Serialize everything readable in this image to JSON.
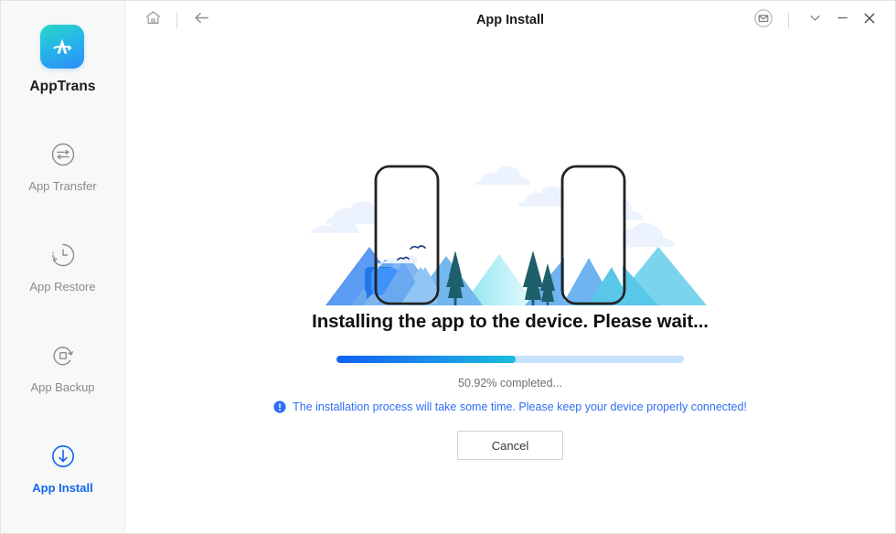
{
  "sidebar": {
    "brand": {
      "name": "AppTrans",
      "logo_icon": "apptrans-logo-icon"
    },
    "items": [
      {
        "label": "App Transfer",
        "icon": "transfer-arrows-icon",
        "active": false
      },
      {
        "label": "App Restore",
        "icon": "clock-restore-icon",
        "active": false
      },
      {
        "label": "App Backup",
        "icon": "backup-refresh-icon",
        "active": false
      },
      {
        "label": "App Install",
        "icon": "download-arrow-icon",
        "active": true
      }
    ]
  },
  "titlebar": {
    "title": "App Install",
    "home_icon": "home-icon",
    "back_icon": "back-arrow-icon",
    "mail_icon": "mail-envelope-icon",
    "menu_icon": "chevron-down-icon",
    "minimize_icon": "minimize-icon",
    "close_icon": "close-icon"
  },
  "main": {
    "illustration_name": "two-phones-landscape-illustration",
    "headline": "Installing the app to the device. Please wait...",
    "progress": {
      "percent": 50.92,
      "fill_ratio": 51.6,
      "label": "50.92% completed..."
    },
    "hint": {
      "icon": "info-exclamation-icon",
      "text": "The installation process will take some time. Please keep your device properly connected!"
    },
    "cancel_label": "Cancel"
  },
  "colors": {
    "accent": "#1266f1",
    "hint_text": "#2f6ef4",
    "progress_start": "#1161f3",
    "progress_end": "#19bedb",
    "progress_track": "#c6e2fc",
    "sidebar_bg": "#f7f8f8"
  }
}
